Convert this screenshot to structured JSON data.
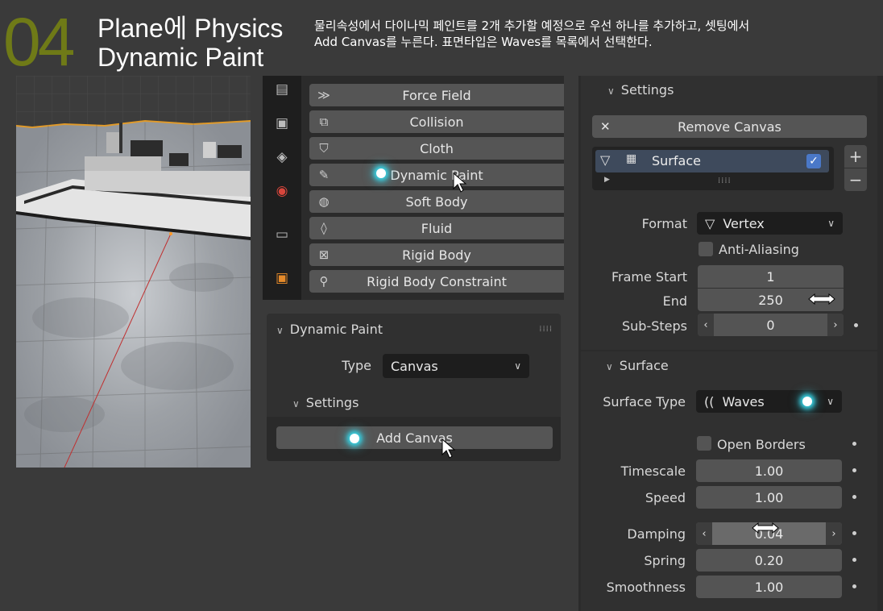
{
  "header": {
    "step_number": "04",
    "title_line1": "Plane에 Physics",
    "title_line2": "Dynamic Paint",
    "desc_line1": "물리속성에서 다이나믹 페인트를  2개 추가할 예정으로 우선 하나를 추가하고,  셋팅에서",
    "desc_line2": "Add Canvas를 누른다. 표면타입은 Waves를 목록에서 선택한다."
  },
  "physics": {
    "buttons": [
      {
        "label": "Force Field",
        "icon": "force-field-icon"
      },
      {
        "label": "Collision",
        "icon": "collision-icon"
      },
      {
        "label": "Cloth",
        "icon": "cloth-icon"
      },
      {
        "label": "Dynamic Paint",
        "icon": "dynamic-paint-icon"
      },
      {
        "label": "Soft Body",
        "icon": "soft-body-icon"
      },
      {
        "label": "Fluid",
        "icon": "fluid-icon"
      },
      {
        "label": "Rigid Body",
        "icon": "rigid-body-icon"
      },
      {
        "label": "Rigid Body Constraint",
        "icon": "rigid-body-constraint-icon"
      }
    ],
    "tab_icons": [
      "output-tab-icon",
      "view-layer-tab-icon",
      "scene-tab-icon",
      "world-tab-icon",
      "collection-tab-icon",
      "object-tab-icon"
    ]
  },
  "dynamic_paint": {
    "title": "Dynamic Paint",
    "type_label": "Type",
    "type_value": "Canvas",
    "settings_label": "Settings",
    "add_canvas_label": "Add Canvas"
  },
  "settings": {
    "title": "Settings",
    "remove_canvas_label": "Remove Canvas",
    "surface_item_label": "Surface",
    "surface_enabled": true,
    "format_label": "Format",
    "format_value": "Vertex",
    "anti_aliasing_label": "Anti-Aliasing",
    "frame_start_label": "Frame Start",
    "frame_start_value": "1",
    "end_label": "End",
    "end_value": "250",
    "sub_steps_label": "Sub-Steps",
    "sub_steps_value": "0"
  },
  "surface": {
    "title": "Surface",
    "surface_type_label": "Surface Type",
    "surface_type_value": "Waves",
    "open_borders_label": "Open Borders",
    "timescale_label": "Timescale",
    "timescale_value": "1.00",
    "speed_label": "Speed",
    "speed_value": "1.00",
    "damping_label": "Damping",
    "damping_value": "0.04",
    "spring_label": "Spring",
    "spring_value": "0.20",
    "smoothness_label": "Smoothness",
    "smoothness_value": "1.00"
  },
  "colors": {
    "step_number": "#6f7a17",
    "highlight_glow": "#38d6e8",
    "checkbox_on": "#4a78c8"
  }
}
